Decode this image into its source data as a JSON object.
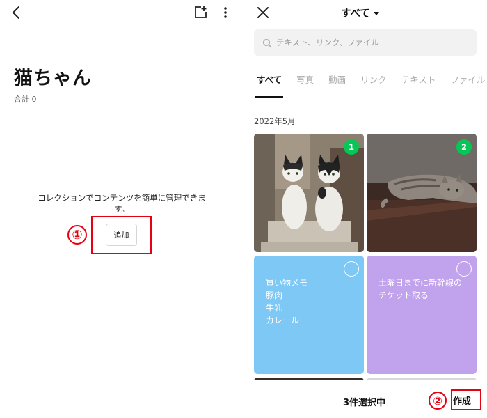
{
  "left": {
    "collection_title": "猫ちゃん",
    "count_text": "合計 0",
    "empty_message": "コレクションでコンテンツを簡単に管理できます。",
    "add_button": "追加",
    "step_marker": "①",
    "icons": [
      "back-icon",
      "add-content-icon",
      "more-icon"
    ]
  },
  "right": {
    "filter_label": "すべて",
    "search_placeholder": "テキスト、リンク、ファイル",
    "tabs": [
      "すべて",
      "写真",
      "動画",
      "リンク",
      "テキスト",
      "ファイル"
    ],
    "active_tab": "すべて",
    "date_header": "2022年5月",
    "tiles": [
      {
        "type": "photo",
        "selected_number": "1"
      },
      {
        "type": "photo",
        "selected_number": "2"
      },
      {
        "type": "memo",
        "lines": [
          "買い物メモ",
          "豚肉",
          "牛乳",
          "カレールー"
        ],
        "color": "#7ec8f5"
      },
      {
        "type": "memo",
        "lines": [
          "土曜日までに新幹線の",
          "チケット取る"
        ],
        "color": "#c1a2ec"
      }
    ],
    "selected_count": "3件選択中",
    "create_button": "作成",
    "step_marker": "②",
    "icons": [
      "close-icon",
      "caret-down-icon",
      "search-icon",
      "check-badge-icon"
    ]
  },
  "colors": {
    "accent_green": "#06c755",
    "annotation_red": "#e60012"
  }
}
